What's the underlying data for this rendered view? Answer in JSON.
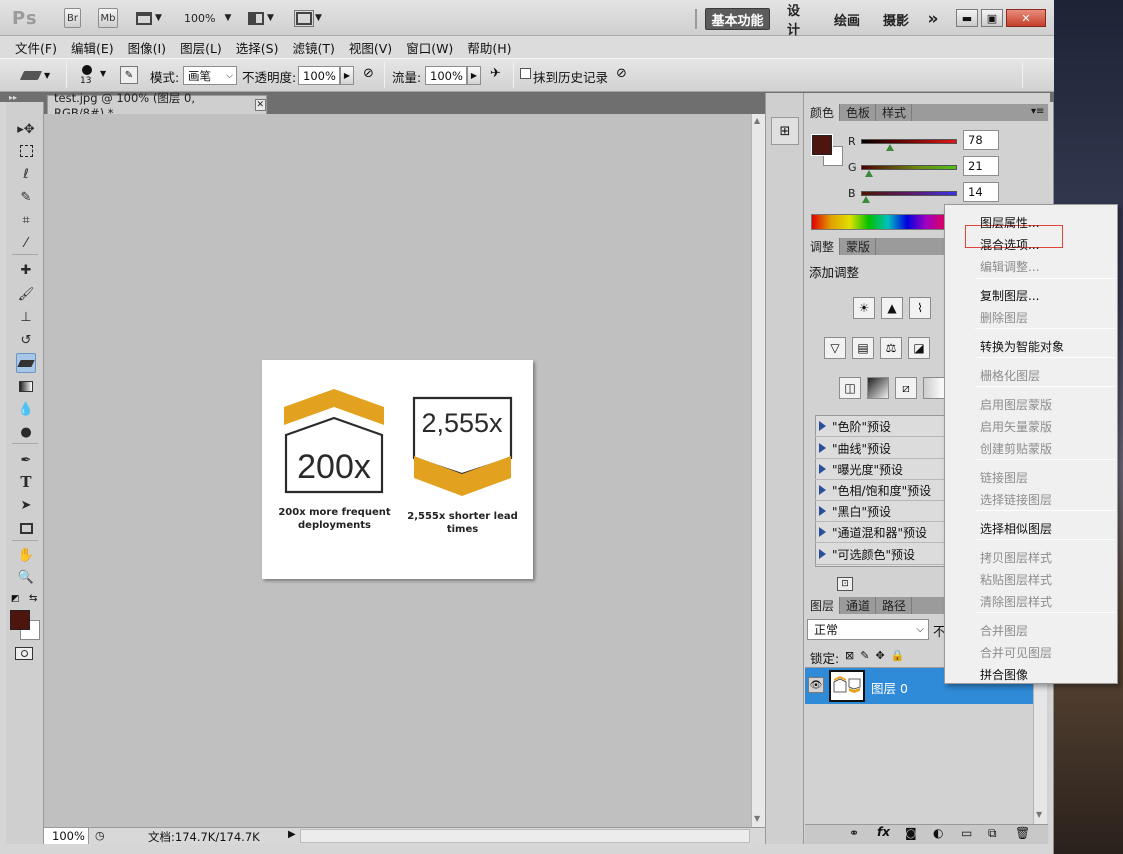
{
  "app": {
    "logo": "Ps",
    "bridge_btn": "Br",
    "minibridge_btn": "Mb",
    "zoom": "100%",
    "workspace_active": "基本功能",
    "workspaces": [
      "设计",
      "绘画",
      "摄影"
    ],
    "more": "»"
  },
  "menu": [
    "文件(F)",
    "编辑(E)",
    "图像(I)",
    "图层(L)",
    "选择(S)",
    "滤镜(T)",
    "视图(V)",
    "窗口(W)",
    "帮助(H)"
  ],
  "options": {
    "brush_size": "13",
    "mode_label": "模式:",
    "mode_value": "画笔",
    "opacity_label": "不透明度:",
    "opacity_value": "100%",
    "flow_label": "流量:",
    "flow_value": "100%",
    "erase_history_label": "抹到历史记录"
  },
  "document": {
    "tab_title": "test.jpg @ 100% (图层 0, RGB/8#) *",
    "zoom": "100%",
    "doc_size": "文档:174.7K/174.7K",
    "image": {
      "left_badge": "200x",
      "left_caption_1": "200x more frequent",
      "left_caption_2": "deployments",
      "right_badge": "2,555x",
      "right_caption_1": "2,555x shorter lead",
      "right_caption_2": "times"
    }
  },
  "color_panel": {
    "tabs": [
      "颜色",
      "色板",
      "样式"
    ],
    "r_label": "R",
    "r_value": "78",
    "g_label": "G",
    "g_value": "21",
    "b_label": "B",
    "b_value": "14",
    "foreground": "#4e150e"
  },
  "adjust_panel": {
    "tabs": [
      "调整",
      "蒙版"
    ],
    "title": "添加调整",
    "presets": [
      "\"色阶\"预设",
      "\"曲线\"预设",
      "\"曝光度\"预设",
      "\"色相/饱和度\"预设",
      "\"黑白\"预设",
      "\"通道混和器\"预设",
      "\"可选颜色\"预设"
    ]
  },
  "layers_panel": {
    "tabs": [
      "图层",
      "通道",
      "路径"
    ],
    "blend_mode": "正常",
    "opacity_prefix": "不",
    "lock_label": "锁定:",
    "layer_name": "图层 0",
    "bottom_icons": [
      "链接",
      "fx",
      "蒙版",
      "调整",
      "组",
      "新建",
      "删除"
    ]
  },
  "context_menu": {
    "items": [
      {
        "label": "图层属性...",
        "enabled": true
      },
      {
        "label": "混合选项...",
        "enabled": true,
        "highlighted": true
      },
      {
        "label": "编辑调整...",
        "enabled": false
      },
      {
        "sep": true
      },
      {
        "label": "复制图层...",
        "enabled": true
      },
      {
        "label": "删除图层",
        "enabled": false
      },
      {
        "sep": true
      },
      {
        "label": "转换为智能对象",
        "enabled": true
      },
      {
        "sep": true
      },
      {
        "label": "栅格化图层",
        "enabled": false
      },
      {
        "sep": true
      },
      {
        "label": "启用图层蒙版",
        "enabled": false
      },
      {
        "label": "启用矢量蒙版",
        "enabled": false
      },
      {
        "label": "创建剪贴蒙版",
        "enabled": false
      },
      {
        "sep": true
      },
      {
        "label": "链接图层",
        "enabled": false
      },
      {
        "label": "选择链接图层",
        "enabled": false
      },
      {
        "sep": true
      },
      {
        "label": "选择相似图层",
        "enabled": true
      },
      {
        "sep": true
      },
      {
        "label": "拷贝图层样式",
        "enabled": false
      },
      {
        "label": "粘贴图层样式",
        "enabled": false
      },
      {
        "label": "清除图层样式",
        "enabled": false
      },
      {
        "sep": true
      },
      {
        "label": "合并图层",
        "enabled": false
      },
      {
        "label": "合并可见图层",
        "enabled": false
      },
      {
        "label": "拼合图像",
        "enabled": true
      }
    ]
  },
  "colors": {
    "accent_orange": "#e2a21f",
    "layer_selected": "#2f8ad8"
  }
}
